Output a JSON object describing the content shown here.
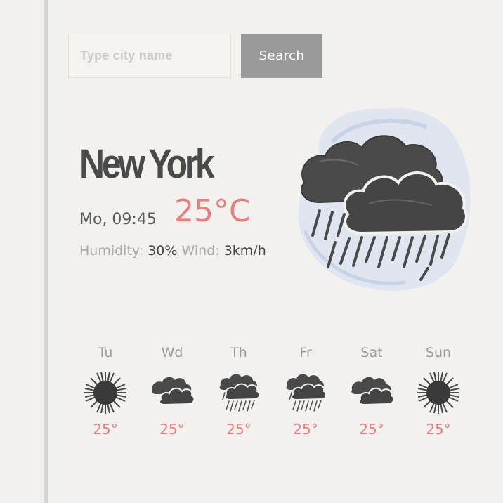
{
  "search": {
    "placeholder": "Type city name",
    "button_label": "Search"
  },
  "current": {
    "city": "New York",
    "datetime": "Mo, 09:45",
    "temperature": "25°C",
    "humidity_label": "Humidity:",
    "humidity_value": "30%",
    "wind_label": "Wind:",
    "wind_value": "3km/h",
    "icon": "rain-cloud-icon"
  },
  "forecast": [
    {
      "day": "Tu",
      "temp": "25°",
      "icon": "sun-icon"
    },
    {
      "day": "Wd",
      "temp": "25°",
      "icon": "cloud-icon"
    },
    {
      "day": "Th",
      "temp": "25°",
      "icon": "rain-cloud-icon"
    },
    {
      "day": "Fr",
      "temp": "25°",
      "icon": "rain-cloud-icon"
    },
    {
      "day": "Sat",
      "temp": "25°",
      "icon": "cloud-icon"
    },
    {
      "day": "Sun",
      "temp": "25°",
      "icon": "sun-icon"
    }
  ],
  "colors": {
    "background": "#f2f1ed",
    "accent": "#e87f7f",
    "button": "#9a9a9a",
    "text_dark": "#4a4a4a",
    "cloud": "#4c4c4c"
  }
}
